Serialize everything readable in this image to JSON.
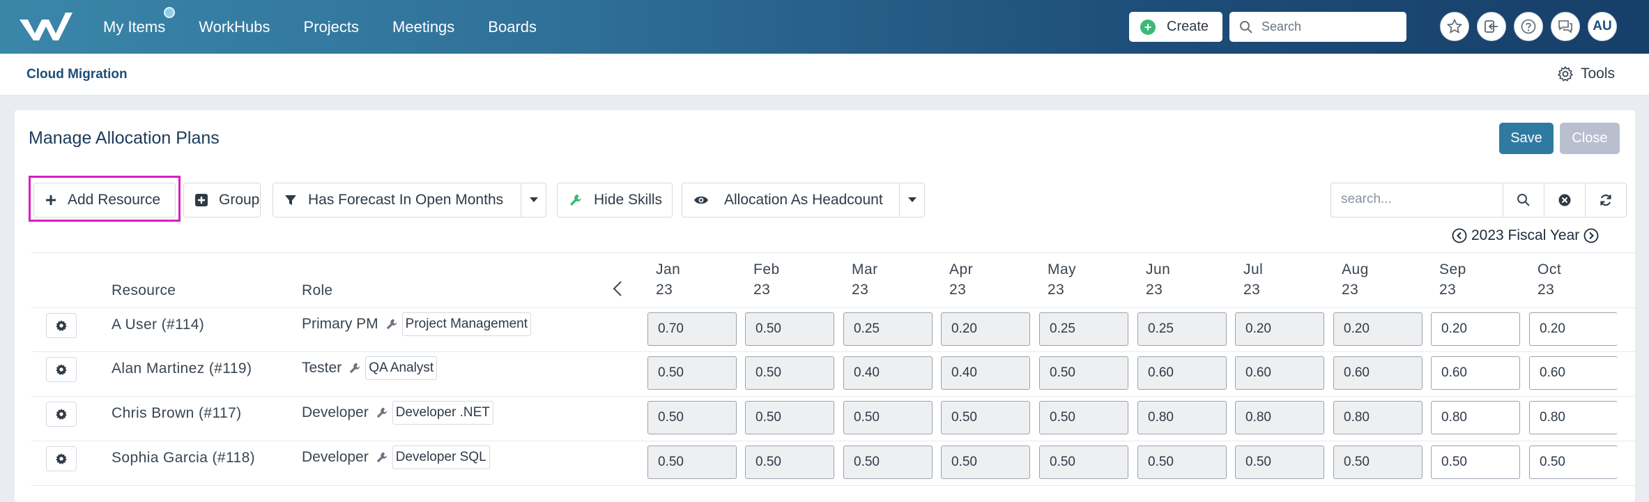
{
  "nav": {
    "items": [
      "My Items",
      "WorkHubs",
      "Projects",
      "Meetings",
      "Boards"
    ],
    "create_label": "Create",
    "search_placeholder": "Search",
    "avatar_initials": "AU"
  },
  "subheader": {
    "project_name": "Cloud Migration",
    "tools_label": "Tools"
  },
  "page": {
    "title": "Manage Allocation Plans",
    "save_label": "Save",
    "close_label": "Close"
  },
  "toolbar": {
    "add_resource": "Add Resource",
    "group": "Group",
    "filter": "Has Forecast In Open Months",
    "hide_skills": "Hide Skills",
    "view_mode": "Allocation As Headcount",
    "search_placeholder": "search..."
  },
  "fiscal_year": "2023 Fiscal Year",
  "table": {
    "col_resource": "Resource",
    "col_role": "Role",
    "months": [
      {
        "m": "Jan",
        "y": "23"
      },
      {
        "m": "Feb",
        "y": "23"
      },
      {
        "m": "Mar",
        "y": "23"
      },
      {
        "m": "Apr",
        "y": "23"
      },
      {
        "m": "May",
        "y": "23"
      },
      {
        "m": "Jun",
        "y": "23"
      },
      {
        "m": "Jul",
        "y": "23"
      },
      {
        "m": "Aug",
        "y": "23"
      },
      {
        "m": "Sep",
        "y": "23"
      },
      {
        "m": "Oct",
        "y": "23"
      }
    ],
    "open_month_start_index": 8,
    "rows": [
      {
        "resource": "A User (#114)",
        "role": "Primary PM",
        "skill": "Project Management",
        "values": [
          "0.70",
          "0.50",
          "0.25",
          "0.20",
          "0.25",
          "0.25",
          "0.20",
          "0.20",
          "0.20",
          "0.20"
        ]
      },
      {
        "resource": "Alan Martinez (#119)",
        "role": "Tester",
        "skill": "QA Analyst",
        "values": [
          "0.50",
          "0.50",
          "0.40",
          "0.40",
          "0.50",
          "0.60",
          "0.60",
          "0.60",
          "0.60",
          "0.60"
        ]
      },
      {
        "resource": "Chris Brown (#117)",
        "role": "Developer",
        "skill": "Developer .NET",
        "values": [
          "0.50",
          "0.50",
          "0.50",
          "0.50",
          "0.50",
          "0.80",
          "0.80",
          "0.80",
          "0.80",
          "0.80"
        ]
      },
      {
        "resource": "Sophia Garcia (#118)",
        "role": "Developer",
        "skill": "Developer SQL",
        "values": [
          "0.50",
          "0.50",
          "0.50",
          "0.50",
          "0.50",
          "0.50",
          "0.50",
          "0.50",
          "0.50",
          "0.50"
        ]
      }
    ]
  }
}
